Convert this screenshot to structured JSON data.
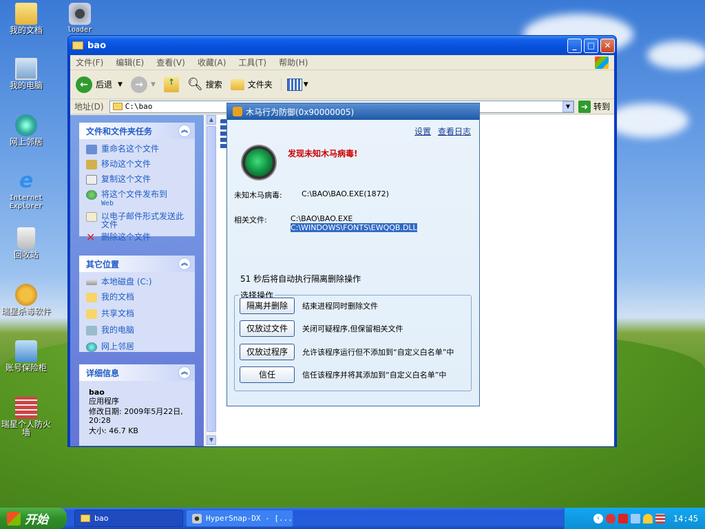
{
  "desktop_icons": [
    {
      "id": "docs",
      "label": "我的文档"
    },
    {
      "id": "loader",
      "label": "loader"
    },
    {
      "id": "computer",
      "label": "我的电脑"
    },
    {
      "id": "network",
      "label": "网上邻居"
    },
    {
      "id": "ie",
      "label": "Internet Explorer"
    },
    {
      "id": "recycle",
      "label": "回收站"
    },
    {
      "id": "rising_av",
      "label": "瑞星杀毒软件"
    },
    {
      "id": "account_safe",
      "label": "账号保险柜"
    },
    {
      "id": "rising_fw",
      "label": "瑞星个人防火墙"
    }
  ],
  "explorer": {
    "title": "bao",
    "menu": [
      "文件(F)",
      "编辑(E)",
      "查看(V)",
      "收藏(A)",
      "工具(T)",
      "帮助(H)"
    ],
    "toolbar": {
      "back": "后退",
      "search": "搜索",
      "folders": "文件夹"
    },
    "address_label": "地址(D)",
    "address_value": "C:\\bao",
    "go_label": "转到",
    "file_tasks": {
      "title": "文件和文件夹任务",
      "items": [
        "重命名这个文件",
        "移动这个文件",
        "复制这个文件",
        "将这个文件发布到",
        "以电子邮件形式发送此文件",
        "删除这个文件"
      ],
      "publish_sub": "Web"
    },
    "other_places": {
      "title": "其它位置",
      "items": [
        "本地磁盘 (C:)",
        "我的文档",
        "共享文档",
        "我的电脑",
        "网上邻居"
      ]
    },
    "details": {
      "title": "详细信息",
      "name": "bao",
      "type": "应用程序",
      "modified": "修改日期: 2009年5月22日, 20:28",
      "size": "大小: 46.7 KB"
    }
  },
  "dialog": {
    "title": "木马行为防御(0x90000005)",
    "links": {
      "settings": "设置",
      "view_log": "查看日志"
    },
    "headline": "发现未知木马病毒!",
    "virus_label": "未知木马病毒:",
    "virus_value": "C:\\BAO\\BAO.EXE(1872)",
    "files_label": "相关文件:",
    "files": [
      "C:\\BAO\\BAO.EXE",
      "C:\\WINDOWS\\FONTS\\EWQQB.DLL"
    ],
    "countdown": "51 秒后将自动执行隔离删除操作",
    "group_label": "选择操作",
    "actions": [
      {
        "label": "隔离并删除",
        "desc": "结束进程同时删除文件"
      },
      {
        "label": "仅放过文件",
        "desc": "关闭可疑程序,但保留相关文件"
      },
      {
        "label": "仅放过程序",
        "desc": "允许该程序运行但不添加到“自定义白名单”中"
      },
      {
        "label": "信任",
        "desc": "信任该程序并将其添加到“自定义白名单”中"
      }
    ]
  },
  "taskbar": {
    "start": "开始",
    "tasks": [
      "bao",
      "HyperSnap-DX - [..."
    ],
    "clock": "14:45"
  }
}
